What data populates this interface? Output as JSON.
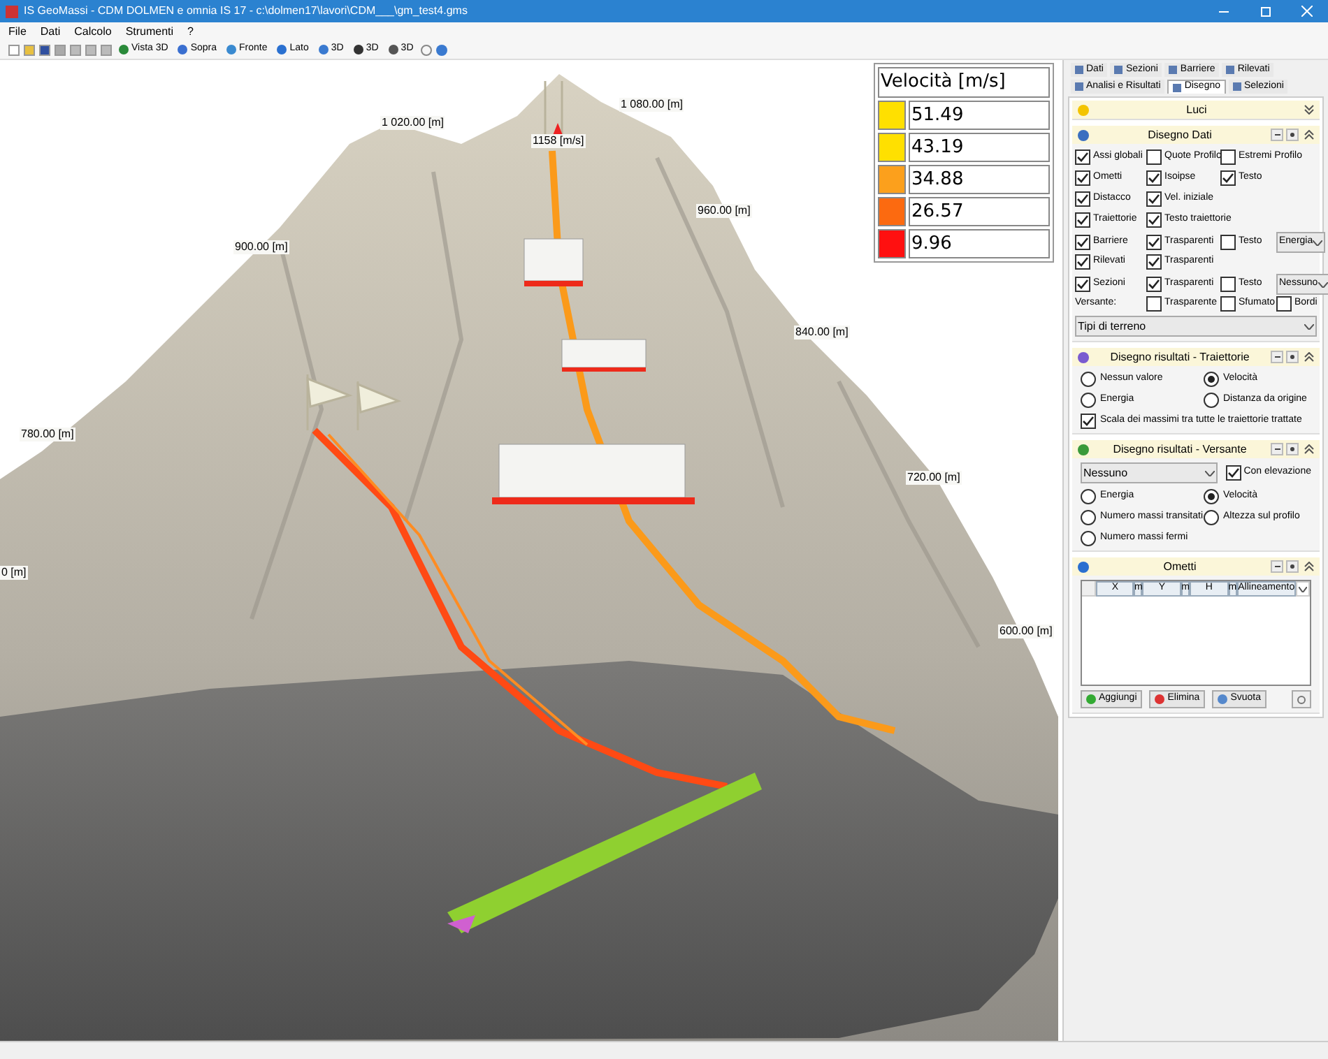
{
  "window": {
    "title": "IS GeoMassi - CDM DOLMEN e omnia IS 17 - c:\\dolmen17\\lavori\\CDM___\\gm_test4.gms"
  },
  "menu": [
    "File",
    "Dati",
    "Calcolo",
    "Strumenti",
    "?"
  ],
  "toolbar": {
    "buttons": [
      "Vista 3D",
      "Sopra",
      "Fronte",
      "Lato",
      "3D",
      "3D",
      "3D"
    ]
  },
  "viewport": {
    "labels": [
      "1 020.00 [m]",
      "1 080.00 [m]",
      "1158 [m/s]",
      "960.00 [m]",
      "900.00 [m]",
      "840.00 [m]",
      "780.00 [m]",
      "720.00 [m]",
      "0 [m]",
      "600.00 [m]"
    ],
    "legend": {
      "title": "Velocità [m/s]",
      "items": [
        {
          "value": "51.49",
          "color": "#ffe000"
        },
        {
          "value": "43.19",
          "color": "#ffe000"
        },
        {
          "value": "34.88",
          "color": "#fca01c"
        },
        {
          "value": "26.57",
          "color": "#fc6a10"
        },
        {
          "value": "9.96",
          "color": "#ff1010"
        }
      ]
    }
  },
  "panel": {
    "tabs": [
      [
        {
          "label": "Dati",
          "selected": false
        },
        {
          "label": "Sezioni",
          "selected": false
        },
        {
          "label": "Barriere",
          "selected": false
        },
        {
          "label": "Rilevati",
          "selected": false
        }
      ],
      [
        {
          "label": "Analisi e Risultati",
          "selected": false
        },
        {
          "label": "Disegno",
          "selected": true
        },
        {
          "label": "Selezioni",
          "selected": false
        }
      ]
    ],
    "sections": [
      {
        "kind": "plain",
        "title": "Luci",
        "expanded": false
      },
      {
        "kind": "grid",
        "title": "Disegno Dati",
        "expanded": true,
        "rows": [
          [
            {
              "kind": "checkbox",
              "label": "Assi globali",
              "checked": true
            },
            {
              "kind": "checkbox",
              "label": "Quote Profilo",
              "checked": false
            },
            {
              "kind": "checkbox",
              "label": "Estremi Profilo",
              "checked": false
            }
          ],
          [
            {
              "kind": "checkbox",
              "label": "Ometti",
              "checked": true
            },
            {
              "kind": "checkbox",
              "label": "Isoipse",
              "checked": true
            },
            {
              "kind": "checkbox",
              "label": "Testo",
              "checked": true
            }
          ],
          [
            {
              "kind": "checkbox",
              "label": "Distacco",
              "checked": true
            },
            {
              "kind": "checkbox",
              "label": "Vel. iniziale",
              "checked": true
            }
          ],
          [
            {
              "kind": "checkbox",
              "label": "Traiettorie",
              "checked": true
            },
            {
              "kind": "checkbox",
              "label": "Testo traiettorie",
              "checked": true
            }
          ],
          [
            {
              "kind": "checkbox",
              "label": "Barriere",
              "checked": true
            },
            {
              "kind": "checkbox",
              "label": "Trasparenti",
              "checked": true
            },
            {
              "kind": "checkbox",
              "label": "Testo",
              "checked": false
            },
            {
              "kind": "select",
              "value": "Energia"
            }
          ],
          [
            {
              "kind": "checkbox",
              "label": "Rilevati",
              "checked": true
            },
            {
              "kind": "checkbox",
              "label": "Trasparenti",
              "checked": true
            }
          ],
          [
            {
              "kind": "checkbox",
              "label": "Sezioni",
              "checked": true
            },
            {
              "kind": "checkbox",
              "label": "Trasparenti",
              "checked": true
            },
            {
              "kind": "checkbox",
              "label": "Testo",
              "checked": false
            },
            {
              "kind": "select",
              "value": "Nessuno"
            }
          ],
          [
            {
              "kind": "label",
              "label": "Versante:"
            },
            {
              "kind": "checkbox",
              "label": "Trasparente",
              "checked": false
            },
            {
              "kind": "checkbox",
              "label": "Sfumato",
              "checked": false
            },
            {
              "kind": "checkbox",
              "label": "Bordi",
              "checked": false
            }
          ]
        ],
        "select": "Tipi di terreno"
      },
      {
        "kind": "radios",
        "title": "Disegno risultati - Traiettorie",
        "expanded": true,
        "radios": [
          {
            "label": "Nessun valore",
            "selected": false
          },
          {
            "label": "Velocità",
            "selected": true
          },
          {
            "label": "Energia",
            "selected": false
          },
          {
            "label": "Distanza da origine",
            "selected": false
          }
        ],
        "checkbox": {
          "label": "Scala dei massimi tra tutte le traiettorie trattate",
          "checked": true
        }
      },
      {
        "kind": "versante",
        "title": "Disegno risultati - Versante",
        "expanded": true,
        "select": "Nessuno",
        "checkbox": {
          "label": "Con elevazione",
          "checked": true
        },
        "radios": [
          {
            "label": "Energia",
            "selected": false
          },
          {
            "label": "Velocità",
            "selected": true
          },
          {
            "label": "Numero massi transitati",
            "selected": false
          },
          {
            "label": "Altezza sul profilo",
            "selected": false
          },
          {
            "label": "Numero massi fermi",
            "selected": false
          }
        ]
      },
      {
        "kind": "table",
        "title": "Ometti",
        "expanded": true,
        "columns": [
          "X",
          "m",
          "Y",
          "m",
          "H",
          "m",
          "Allineamento"
        ],
        "buttons": [
          "Aggiungi",
          "Elimina",
          "Svuota"
        ]
      }
    ]
  }
}
